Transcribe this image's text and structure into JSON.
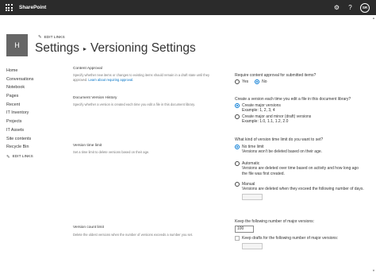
{
  "suite": {
    "brand": "SharePoint",
    "avatar_initials": "SR",
    "icons": [
      "app-launcher-icon",
      "gear-icon",
      "help-icon"
    ]
  },
  "site": {
    "logo_letter": "H",
    "edit_links": "EDIT LINKS"
  },
  "page": {
    "title_part1": "Settings",
    "title_sep": "▸",
    "title_part2": "Versioning Settings"
  },
  "leftnav": {
    "items": [
      {
        "label": "Home"
      },
      {
        "label": "Conversations"
      },
      {
        "label": "Notebook"
      },
      {
        "label": "Pages"
      },
      {
        "label": "Recent"
      },
      {
        "label": "IT Inventory"
      },
      {
        "label": "Projects"
      },
      {
        "label": "IT Assets"
      },
      {
        "label": "Site contents"
      },
      {
        "label": "Recycle Bin"
      }
    ],
    "edit_links": "EDIT LINKS"
  },
  "sections": {
    "content_approval": {
      "title": "Content Approval",
      "desc": "Specify whether new items or changes to existing items should remain in a draft state until they",
      "desc2_prefix": "approved. ",
      "desc2_link": "Learn about requiring approval.",
      "question": "Require content approval for submitted items?",
      "yes": "Yes",
      "no": "No",
      "selected": "No"
    },
    "version_history": {
      "title": "Document Version History",
      "desc": "Specify whether a version is created each time you edit a file in this document library.",
      "question": "Create a version each time you edit a file in this document library?",
      "opt1": "Create major versions",
      "opt1_example": "Example: 1, 2, 3, 4",
      "opt2": "Create major and minor (draft) versions",
      "opt2_example": "Example: 1.0, 1.1, 1.2, 2.0",
      "selected": "Create major versions"
    },
    "time_limit": {
      "title": "Version time limit",
      "desc": "Set a time limit to delete versions based on their age.",
      "question": "What kind of version time limit do you want to set?",
      "opt1": "No time limit",
      "opt1_sub": "Versions won't be deleted based on their age.",
      "opt2": "Automatic",
      "opt2_sub1": "Versions are deleted over time based on activity and how long ago",
      "opt2_sub2": "the file was first created.",
      "opt3": "Manual",
      "opt3_sub": "Versions are deleted when they exceed the following number of days.",
      "selected": "No time limit"
    },
    "count_limit": {
      "title": "Version count limit",
      "desc": "Delete the oldest versions when the number of versions exceeds a number you set.",
      "keep_label": "Keep the following number of major versions:",
      "keep_value": "100",
      "drafts_label": "Keep drafts for the following number of major versions:",
      "drafts_checked": false
    }
  }
}
